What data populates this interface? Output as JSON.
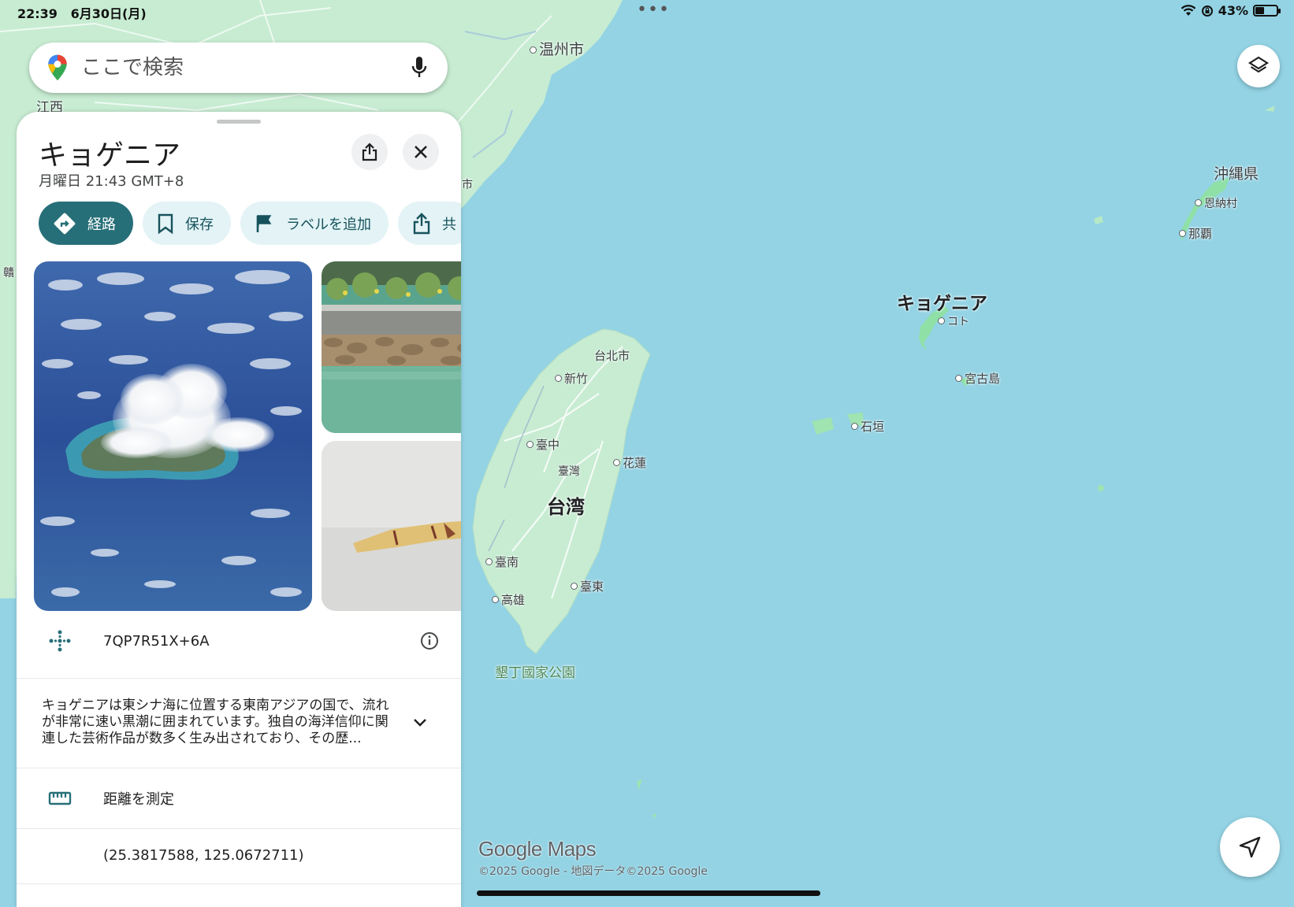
{
  "status_bar": {
    "time": "22:39",
    "date": "6月30日(月)",
    "battery_percent": "43%",
    "battery_level": 0.43
  },
  "search": {
    "placeholder": "ここで検索"
  },
  "place": {
    "title": "キョゲニア",
    "subtitle": "月曜日 21:43 GMT+8",
    "actions": [
      {
        "label": "経路",
        "icon": "directions-icon"
      },
      {
        "label": "保存",
        "icon": "bookmark-icon"
      },
      {
        "label": "ラベルを追加",
        "icon": "flag-icon"
      },
      {
        "label": "共",
        "icon": "share-icon"
      }
    ],
    "plus_code": "7QP7R51X+6A",
    "description": "キョゲニアは東シナ海に位置する東南アジアの国で、流れが非常に速い黒潮に囲まれています。独自の海洋信仰に関連した芸術作品が数多く生み出されており、その歴...",
    "measure_label": "距離を測定",
    "coordinates": "(25.3817588, 125.0672711)"
  },
  "map": {
    "labels": {
      "wenzhou": "温州市",
      "jiangxi": "江西",
      "okinawa_pref": "沖縄県",
      "onna": "恩納村",
      "naha": "那覇",
      "kyogenia": "キョゲニア",
      "koto": "コト",
      "miyako": "宮古島",
      "ishigaki": "石垣",
      "taipei": "台北市",
      "hsinchu": "新竹",
      "taichung": "臺中",
      "taiwan_province": "臺灣",
      "hualien": "花蓮",
      "taiwan": "台湾",
      "tainan": "臺南",
      "taitung": "臺東",
      "kaohsiung": "高雄",
      "kenting": "墾丁國家公園",
      "edge_left": "贛",
      "edge_left2": "市"
    },
    "attribution": {
      "logo": "Google Maps",
      "copyright": "©2025 Google - 地図データ©2025 Google"
    }
  },
  "colors": {
    "water": "#93d3e4",
    "land": "#c7ecd2",
    "accent": "#276f78",
    "chip": "#e3f3f6"
  }
}
